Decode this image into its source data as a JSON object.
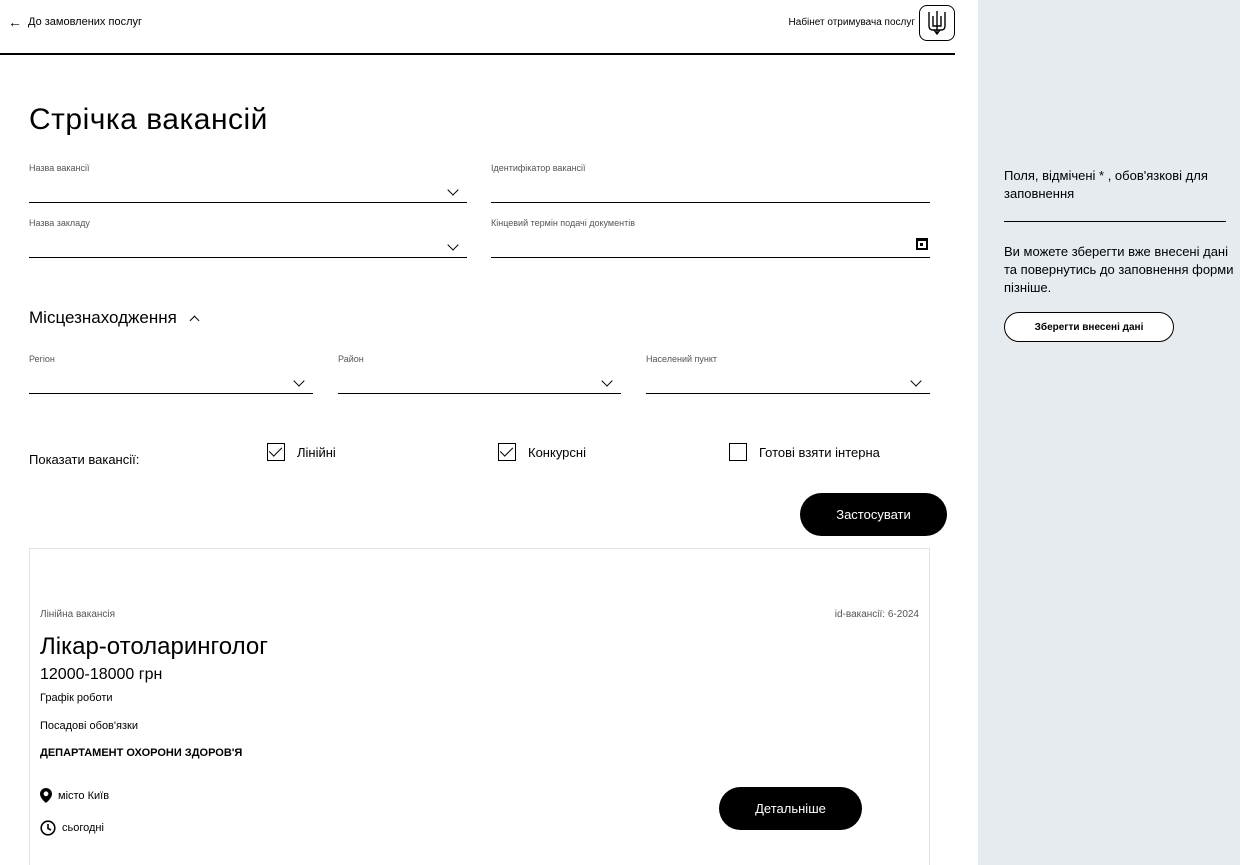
{
  "header": {
    "back_label": "До замовлених послуг",
    "cabinet_label": "Набінет отримувача послуг"
  },
  "main": {
    "title": "Стрічка вакансій",
    "fields": {
      "vacancy_name": "Назва вакансії",
      "vacancy_id": "Ідентифікатор вакансії",
      "institution": "Назва закладу",
      "deadline": "Кінцевий термін подачі документів"
    },
    "location": {
      "title": "Місцезнаходження",
      "region": "Регіон",
      "district": "Район",
      "settlement": "Населений пункт"
    },
    "show": {
      "label": "Показати вакансії:",
      "options": [
        {
          "label": "Лінійні",
          "checked": true
        },
        {
          "label": "Конкурсні",
          "checked": true
        },
        {
          "label": "Готові взяти інтерна",
          "checked": false
        }
      ]
    },
    "apply_label": "Застосувати"
  },
  "card": {
    "type": "Лінійна вакансія",
    "vacancy_id": "id-вакансії: 6-2024",
    "job_title": "Лікар-отоларинголог",
    "salary": "12000-18000 грн",
    "schedule": "Графік роботи",
    "duties": "Посадові обов'язки",
    "department": "ДЕПАРТАМЕНТ ОХОРОНИ ЗДОРОВ'Я",
    "location": "місто Київ",
    "posted": "сьогодні",
    "details_label": "Детальніше"
  },
  "sidebar": {
    "required_note": "Поля, відмічені * , обов'язкові для заповнення",
    "save_note": "Ви можете зберегти вже внесені дані та повернутись до заповнення форми пізніше.",
    "save_label": "Зберегти внесені дані"
  }
}
